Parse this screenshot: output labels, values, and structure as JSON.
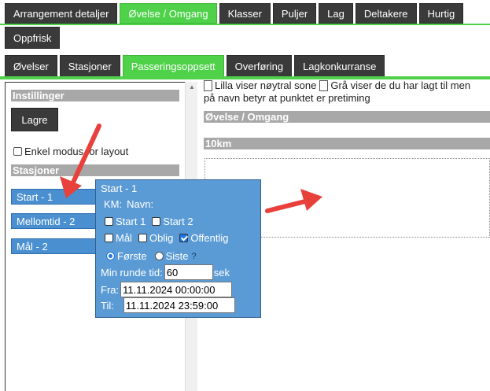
{
  "top_tabs": [
    {
      "label": "Arrangement detaljer",
      "active": false
    },
    {
      "label": "Øvelse / Omgang",
      "active": true
    },
    {
      "label": "Klasser",
      "active": false
    },
    {
      "label": "Puljer",
      "active": false
    },
    {
      "label": "Lag",
      "active": false
    },
    {
      "label": "Deltakere",
      "active": false
    },
    {
      "label": "Hurtig",
      "active": false
    }
  ],
  "refresh_label": "Oppfrisk",
  "sub_tabs": [
    {
      "label": "Øvelser",
      "active": false
    },
    {
      "label": "Stasjoner",
      "active": false
    },
    {
      "label": "Passeringsoppsett",
      "active": true
    },
    {
      "label": "Overføring",
      "active": false
    },
    {
      "label": "Lagkonkurranse",
      "active": false
    }
  ],
  "left": {
    "settings_heading": "Instillinger",
    "save_label": "Lagre",
    "simple_mode_label": "Enkel modus for layout",
    "stations_heading": "Stasjoner",
    "stations": [
      "Start - 1",
      "Mellomtid - 2",
      "Mål - 2"
    ]
  },
  "info": {
    "line1_a": "Lilla viser nøytral sone",
    "line1_b": "Grå viser de du har lagt til men",
    "line2": "på navn betyr at punktet er pretiming"
  },
  "right": {
    "exercise_heading": "Øvelse / Omgang",
    "distance_heading": "10km"
  },
  "popup": {
    "title": "Start - 1",
    "km_label": "KM:",
    "name_label": "Navn:",
    "start1_label": "Start 1",
    "start2_label": "Start 2",
    "goal_label": "Mål",
    "mandatory_label": "Oblig",
    "public_label": "Offentlig",
    "first_label": "Første",
    "last_label": "Siste",
    "help_label": "?",
    "min_lap_label": "Min runde tid:",
    "min_lap_value": "60",
    "sec_label": "sek",
    "from_label": "Fra:",
    "from_value": "11.11.2024 00:00:00",
    "to_label": "Til:",
    "to_value": "11.11.2024 23:59:00"
  },
  "colors": {
    "accent_green": "#4fd14a",
    "tab_dark": "#3a3a3a",
    "popup_blue": "#5b9bd5",
    "arrow_red": "#e8403a"
  }
}
